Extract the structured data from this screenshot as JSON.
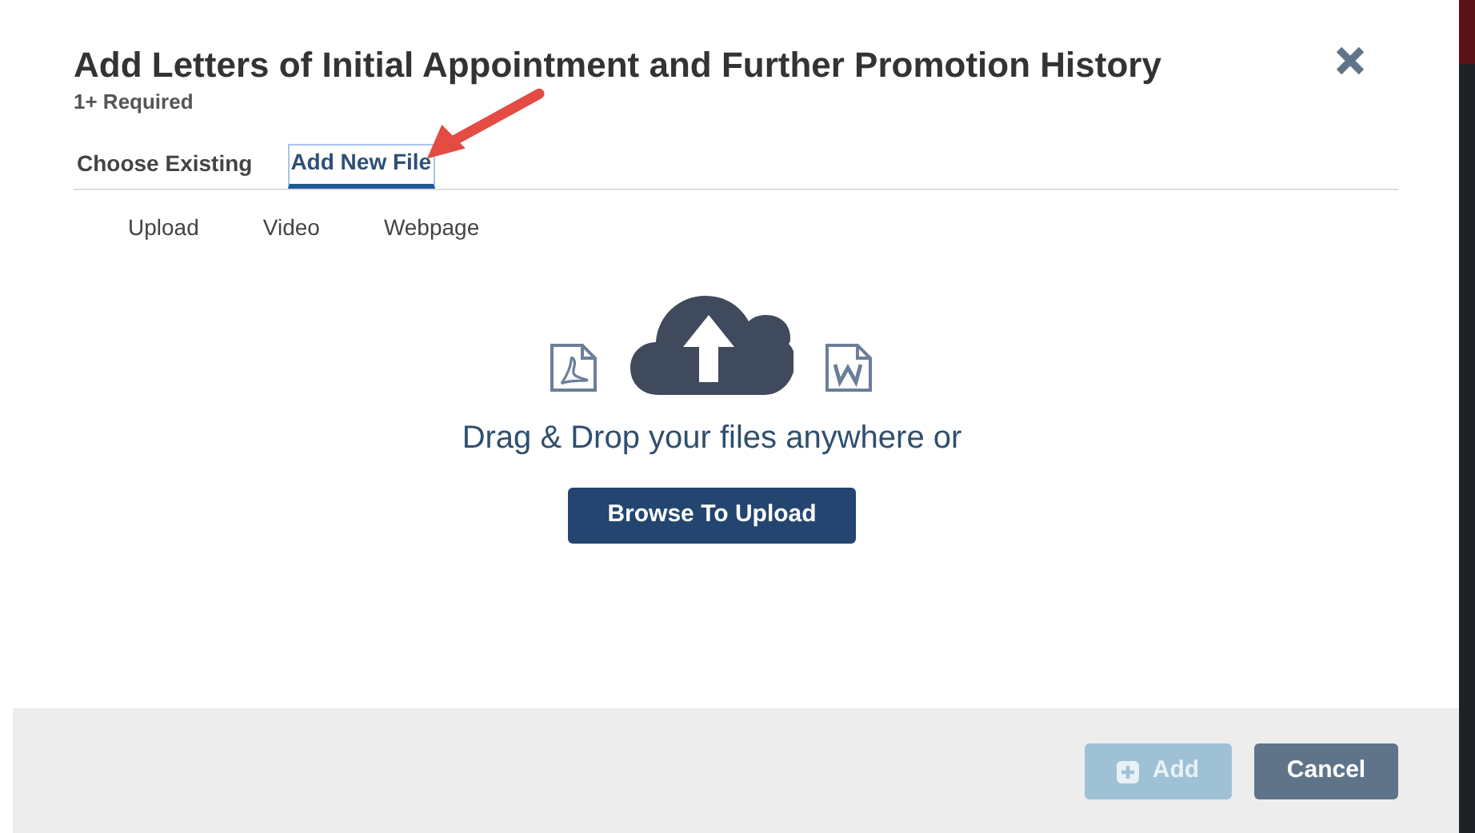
{
  "dialog": {
    "title": "Add Letters of Initial Appointment and Further Promotion History",
    "subtitle": "1+ Required"
  },
  "tabs": [
    {
      "label": "Choose Existing",
      "selected": false
    },
    {
      "label": "Add New File",
      "selected": true
    }
  ],
  "source_tabs": [
    {
      "label": "Upload"
    },
    {
      "label": "Video"
    },
    {
      "label": "Webpage"
    }
  ],
  "upload": {
    "prompt": "Drag & Drop your files anywhere or",
    "button": "Browse To Upload"
  },
  "footer": {
    "buttons": [
      {
        "label": "Add",
        "kind": "primary",
        "disabled": true
      },
      {
        "label": "Cancel",
        "kind": "secondary",
        "disabled": false
      }
    ]
  }
}
